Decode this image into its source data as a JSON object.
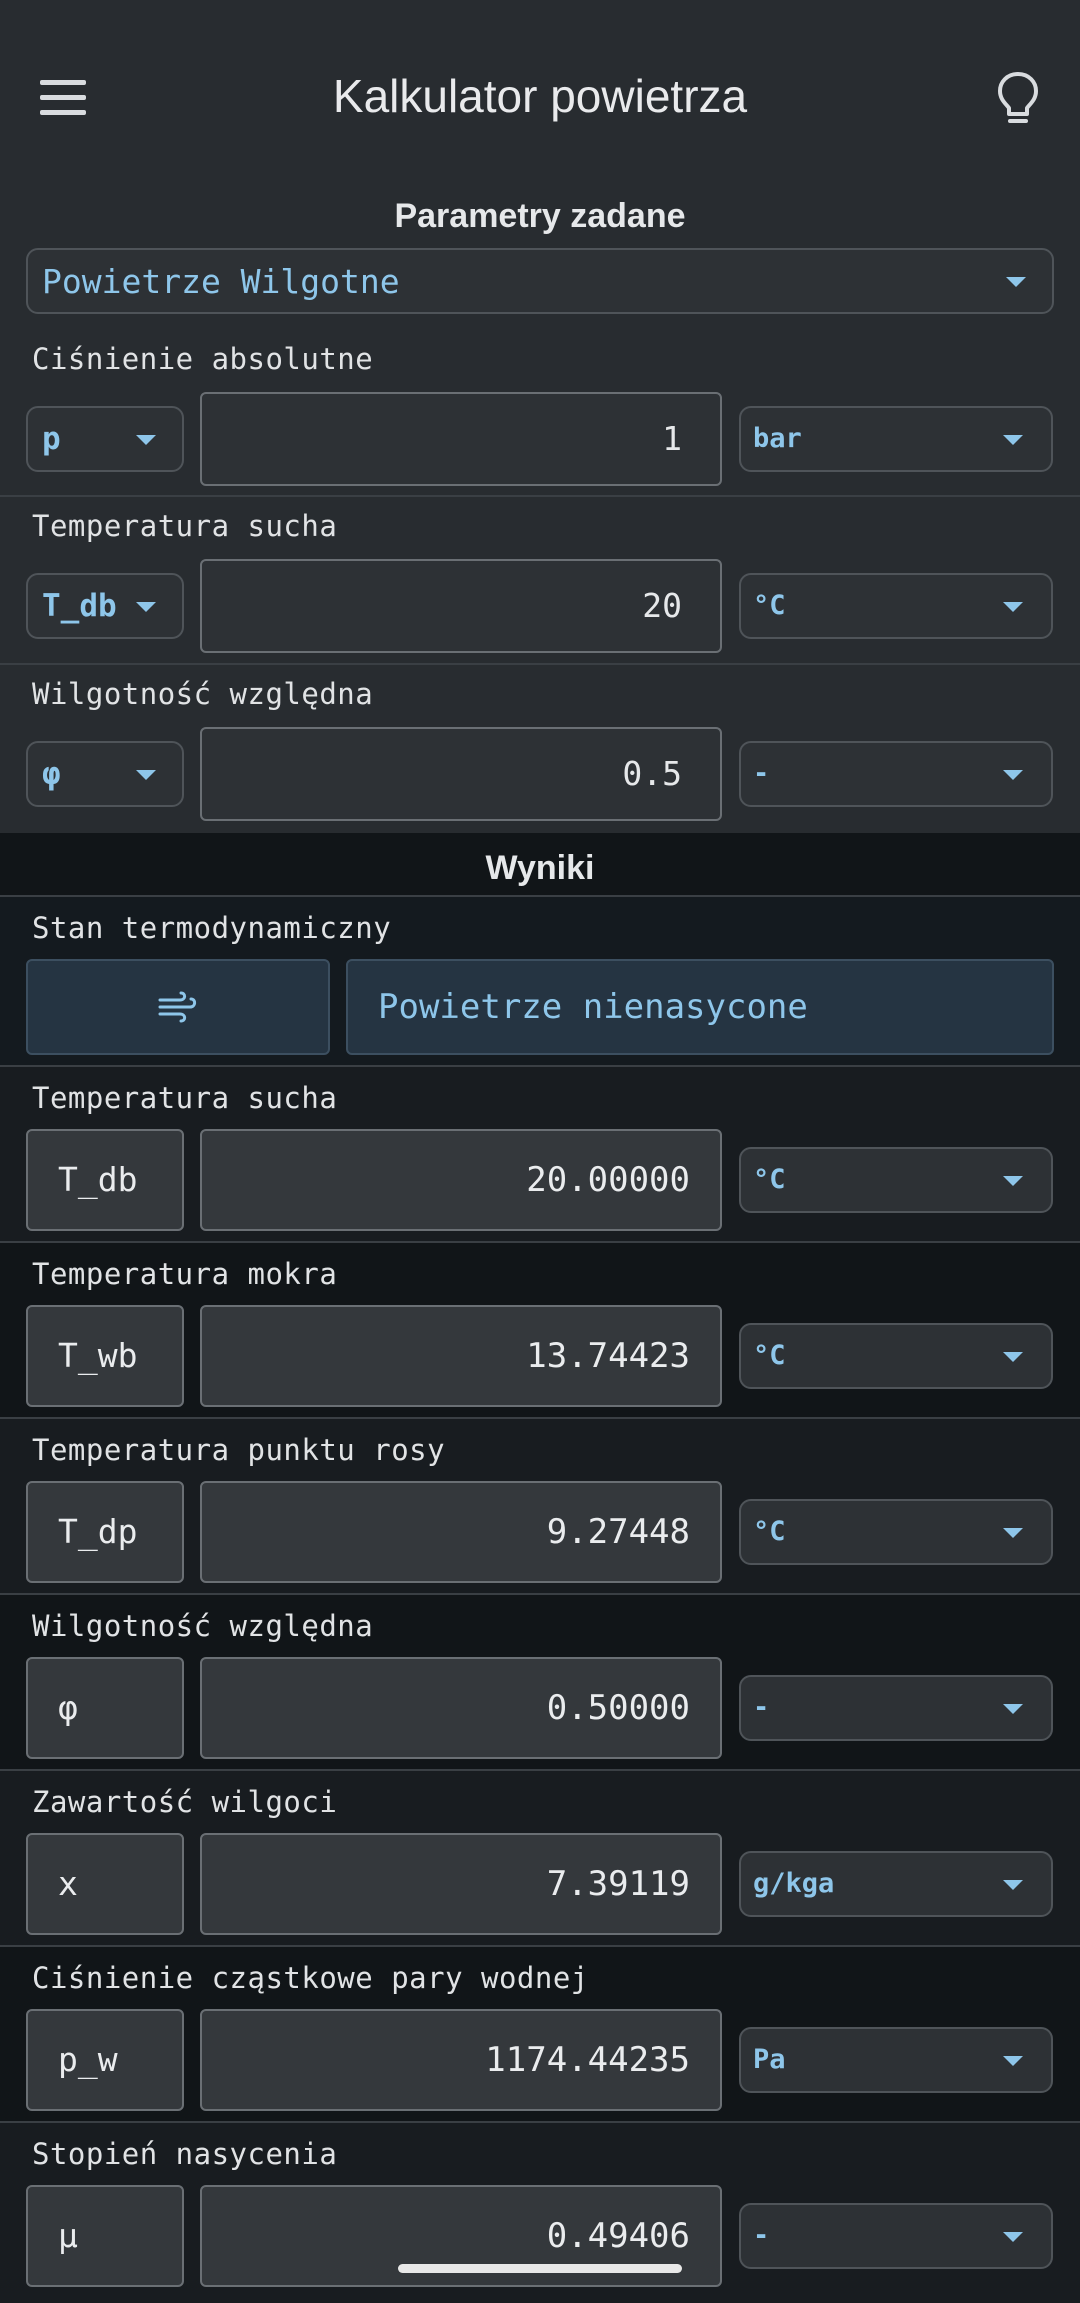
{
  "app": {
    "title": "Kalkulator powietrza"
  },
  "inputs": {
    "section_title": "Parametry zadane",
    "mode": "Powietrze Wilgotne",
    "rows": [
      {
        "label": "Ciśnienie absolutne",
        "symbol": "p",
        "value": "1",
        "unit": "bar"
      },
      {
        "label": "Temperatura sucha",
        "symbol": "T_db",
        "value": "20",
        "unit": "°C"
      },
      {
        "label": "Wilgotność względna",
        "symbol": "φ",
        "value": "0.5",
        "unit": "-"
      }
    ]
  },
  "results": {
    "section_title": "Wyniki",
    "state": {
      "label": "Stan termodynamiczny",
      "icon": "air-wind-icon",
      "value": "Powietrze nienasycone"
    },
    "rows": [
      {
        "label": "Temperatura sucha",
        "symbol": "T_db",
        "value": "20.00000",
        "unit": "°C"
      },
      {
        "label": "Temperatura mokra",
        "symbol": "T_wb",
        "value": "13.74423",
        "unit": "°C"
      },
      {
        "label": "Temperatura punktu rosy",
        "symbol": "T_dp",
        "value": "9.27448",
        "unit": "°C"
      },
      {
        "label": "Wilgotność względna",
        "symbol": "φ",
        "value": "0.50000",
        "unit": "-"
      },
      {
        "label": "Zawartość wilgoci",
        "symbol": "x",
        "value": "7.39119",
        "unit": "g/kga"
      },
      {
        "label": "Ciśnienie cząstkowe pary wodnej",
        "symbol": "p_w",
        "value": "1174.44235",
        "unit": "Pa"
      },
      {
        "label": "Stopień nasycenia",
        "symbol": "μ",
        "value": "0.49406",
        "unit": "-"
      }
    ]
  },
  "colors": {
    "accent": "#8ec6ea",
    "input_bg": "#282c30",
    "results_bg": "#111518",
    "state_bg": "#253442"
  }
}
